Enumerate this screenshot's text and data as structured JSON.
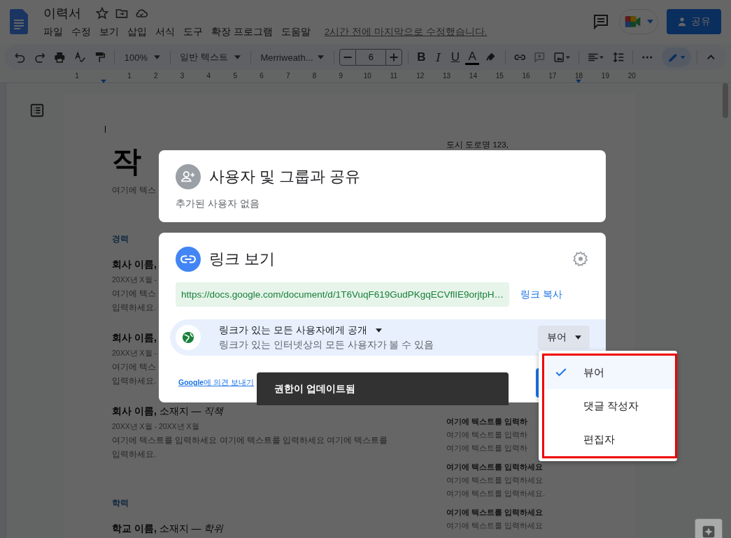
{
  "app": {
    "title": "이력서",
    "menu": [
      "파일",
      "수정",
      "보기",
      "삽입",
      "서식",
      "도구",
      "확장 프로그램",
      "도움말"
    ],
    "last_edit": "2시간 전에 마지막으로 수정했습니다.",
    "share_button": "공유"
  },
  "toolbar": {
    "zoom": "100%",
    "style": "일반 텍스트",
    "font": "Merriweath...",
    "font_size": "6",
    "format": [
      "B",
      "I",
      "U",
      "A"
    ]
  },
  "ruler": {
    "labels": [
      "1",
      "1",
      "2",
      "3",
      "4",
      "5",
      "6",
      "7",
      "8",
      "9",
      "10",
      "11",
      "12",
      "13",
      "14",
      "15",
      "16",
      "17",
      "18",
      "19",
      "20"
    ]
  },
  "document": {
    "left": [
      {
        "kind": "title",
        "text": "작"
      },
      {
        "kind": "text",
        "text": "여기에 텍스"
      },
      {
        "kind": "section",
        "text": "경력"
      },
      {
        "kind": "role_name",
        "text": "회사 이름,"
      },
      {
        "kind": "date",
        "text": "20XX년 X월 -"
      },
      {
        "kind": "text",
        "text": "여기에 텍스"
      },
      {
        "kind": "text",
        "text": "입력하세요."
      },
      {
        "kind": "role_name",
        "text": "회사 이름,"
      },
      {
        "kind": "date",
        "text": "20XX년 X월 -"
      },
      {
        "kind": "text",
        "text": "여기에 텍스"
      },
      {
        "kind": "text",
        "text": "입력하세요."
      },
      {
        "kind": "role",
        "text": "**회사 이름,** 소재지 — *직책*"
      },
      {
        "kind": "date",
        "text": "20XX년 X월 - 20XX년 X월"
      },
      {
        "kind": "text",
        "text": "여기에 텍스트를 입력하세요 여기에 텍스트를 입력하세요 여기에 텍스트를"
      },
      {
        "kind": "text",
        "text": "입력하세요."
      },
      {
        "kind": "section",
        "text": "학력"
      },
      {
        "kind": "role",
        "text": "**학교 이름,** 소재지 — *학위*"
      }
    ],
    "address": "도시 도로명 123,",
    "groups": [
      {
        "heading": "여기에 텍스트를 입력하",
        "lines": [
          "여기에 텍스트를 입력하",
          "여기에 텍스트를 입력하"
        ]
      },
      {
        "heading": "여기에 텍스트를 입력하세요",
        "lines": [
          "여기에 텍스트를 입력하세요",
          "여기에 텍스트를 입력하세요."
        ]
      },
      {
        "heading": "여기에 텍스트를 입력하세요",
        "lines": [
          "여기에 텍스트를 입력하세요"
        ]
      }
    ]
  },
  "share_dialog": {
    "people_title": "사용자 및 그룹과 공유",
    "people_note": "추가된 사용자 없음",
    "link_title": "링크 보기",
    "link_url": "https://docs.google.com/document/d/1T6VuqF619GudPKgqECVflIE9orjtpH…",
    "copy_link": "링크 복사",
    "access": {
      "label": "링크가 있는 모든 사용자에게 공개",
      "description": "링크가 있는 인터넷상의 모든 사용자가 볼 수 있음",
      "role": "뷰어"
    },
    "feedback_link": "**Google**에 의견 보내기"
  },
  "snackbar": "권한이 업데이트됨",
  "role_menu": {
    "items": [
      {
        "label": "뷰어",
        "selected": true
      },
      {
        "label": "댓글 작성자",
        "selected": false
      },
      {
        "label": "편집자",
        "selected": false
      }
    ]
  }
}
